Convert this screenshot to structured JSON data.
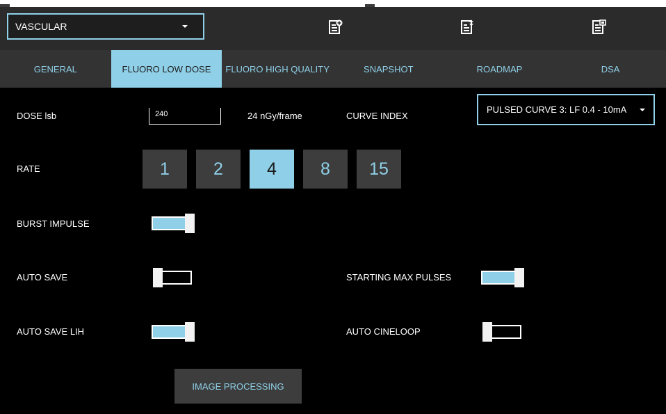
{
  "header": {
    "preset": "VASCULAR",
    "icons": [
      "add-document-icon",
      "sort-document-icon",
      "image-document-icon"
    ]
  },
  "tabs": [
    {
      "label": "GENERAL",
      "active": false
    },
    {
      "label": "FLUORO LOW DOSE",
      "active": true
    },
    {
      "label": "FLUORO HIGH QUALITY",
      "active": false
    },
    {
      "label": "SNAPSHOT",
      "active": false
    },
    {
      "label": "ROADMAP",
      "active": false
    },
    {
      "label": "DSA",
      "active": false
    }
  ],
  "dose": {
    "label": "DOSE lsb",
    "value": "240",
    "per_frame": "24 nGy/frame"
  },
  "curve": {
    "label": "CURVE INDEX",
    "value": "PULSED CURVE 3: LF 0.4 - 10mA"
  },
  "rate": {
    "label": "RATE",
    "options": [
      "1",
      "2",
      "4",
      "8",
      "15"
    ],
    "selected": "4"
  },
  "toggles": {
    "burst_impulse": {
      "label": "BURST IMPULSE",
      "on": true
    },
    "auto_save": {
      "label": "AUTO SAVE",
      "on": false
    },
    "starting_max_pulses": {
      "label": "STARTING MAX PULSES",
      "on": true
    },
    "auto_save_lih": {
      "label": "AUTO SAVE LIH",
      "on": true
    },
    "auto_cineloop": {
      "label": "AUTO CINELOOP",
      "on": false
    }
  },
  "image_processing": {
    "label": "IMAGE PROCESSING"
  },
  "colors": {
    "accent": "#8fd0e8",
    "background": "#000000",
    "header": "#2b2b2b",
    "tab_bar": "#333333",
    "button": "#3d3d3d"
  }
}
